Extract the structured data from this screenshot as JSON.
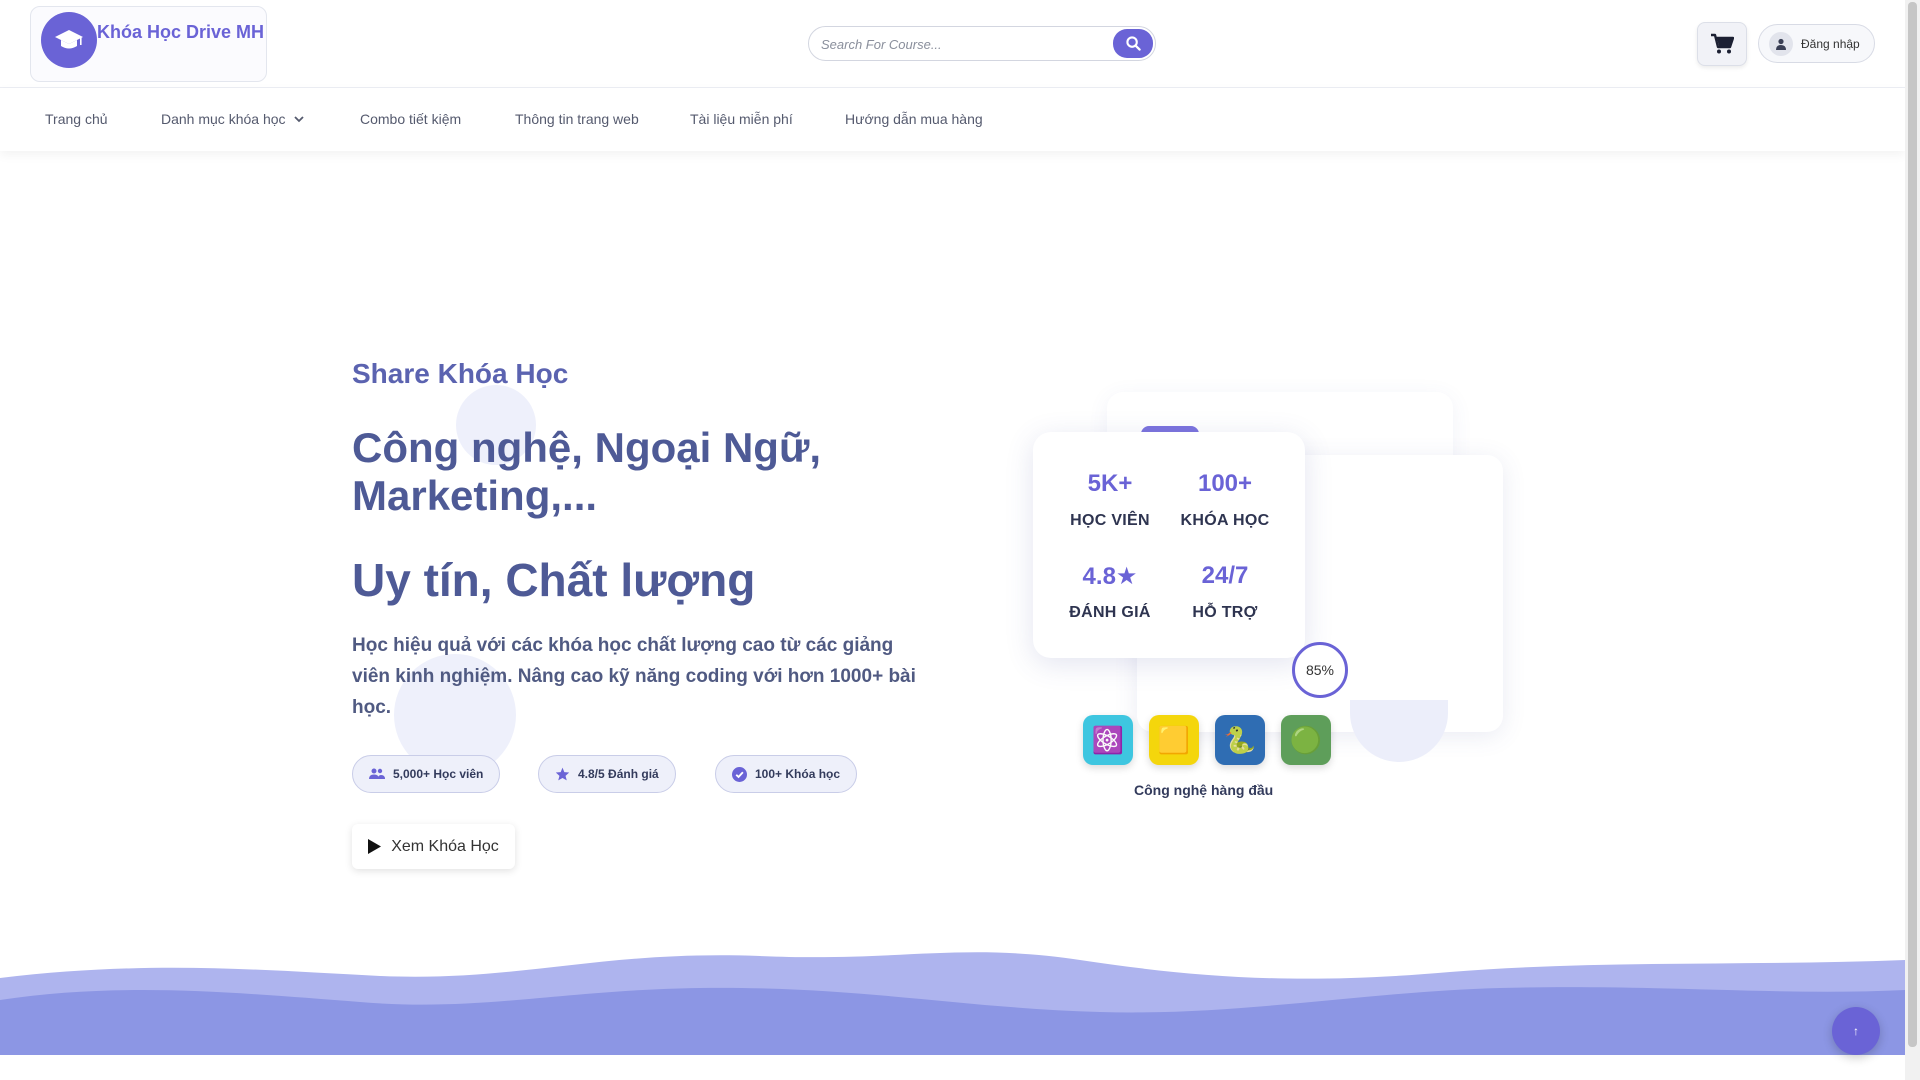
{
  "header": {
    "logo_text": "Khóa Học Drive MH",
    "search_placeholder": "Search For Course...",
    "login_label": "Đăng nhập"
  },
  "nav": {
    "items": [
      {
        "label": "Trang chủ"
      },
      {
        "label": "Danh mục khóa học"
      },
      {
        "label": "Combo tiết kiệm"
      },
      {
        "label": "Thông tin trang web"
      },
      {
        "label": "Tài liệu miễn phí"
      },
      {
        "label": "Hướng dẫn mua hàng"
      }
    ]
  },
  "hero": {
    "tagline": "Share Khóa Học",
    "headline": "Công nghệ, Ngoại Ngữ, Marketing,...",
    "headline2": "Uy tín, Chất lượng",
    "description": "Học hiệu quả với các khóa học chất lượng cao từ các giảng viên kinh nghiệm. Nâng cao kỹ năng coding với hơn 1000+ bài học.",
    "chips": [
      {
        "label": "5,000+ Học viên",
        "icon": "users-icon"
      },
      {
        "label": "4.8/5 Đánh giá",
        "icon": "star-icon"
      },
      {
        "label": "100+ Khóa học",
        "icon": "check-circle-icon"
      }
    ],
    "cta_label": "Xem Khóa Học"
  },
  "stats": [
    {
      "value": "5K+",
      "label": "HỌC VIÊN"
    },
    {
      "value": "100+",
      "label": "KHÓA HỌC"
    },
    {
      "value": "4.8★",
      "label": "ĐÁNH GIÁ"
    },
    {
      "value": "24/7",
      "label": "HỖ TRỢ"
    }
  ],
  "progress": {
    "label": "85%",
    "value": 85
  },
  "tech": {
    "icons": [
      {
        "glyph": "⚛️",
        "name": "react-icon",
        "color": "#3ec6e0"
      },
      {
        "glyph": "🟨",
        "name": "javascript-icon",
        "color": "#f4d60c"
      },
      {
        "glyph": "🐍",
        "name": "python-icon",
        "color": "#2f6db3"
      },
      {
        "glyph": "🟢",
        "name": "nodejs-icon",
        "color": "#5e9e5a"
      }
    ],
    "caption": "Công nghệ hàng đầu"
  },
  "scroll_top_label": "↑",
  "colors": {
    "accent": "#6a63d6",
    "heading": "#4e5a96",
    "wave_light": "#aeb4ee",
    "wave_dark": "#8c96e4"
  }
}
